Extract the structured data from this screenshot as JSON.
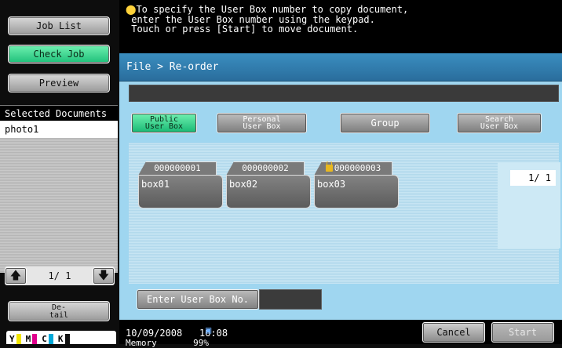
{
  "left": {
    "job_list": "Job List",
    "check_job": "Check Job",
    "preview": "Preview",
    "selected_documents_label": "Selected Documents",
    "selected_documents": [
      "photo1"
    ],
    "page_indicator": "1/ 1",
    "detail_line1": "De-",
    "detail_line2": "tail",
    "toner": [
      {
        "label": "Y",
        "color": "#f2e600"
      },
      {
        "label": "M",
        "color": "#e0008c"
      },
      {
        "label": "C",
        "color": "#00a8d8"
      },
      {
        "label": "K",
        "color": "#111111"
      }
    ]
  },
  "message": {
    "line1": "To specify the User Box number to copy document,",
    "line2": " enter the User Box number using the keypad.",
    "line3": " Touch or press [Start] to move document."
  },
  "main": {
    "breadcrumb": "File > Re-order",
    "tabs": [
      {
        "line1": "Public",
        "line2": "User Box",
        "active": true
      },
      {
        "line1": "Personal",
        "line2": "User Box",
        "active": false
      },
      {
        "line1": "Group",
        "line2": "",
        "active": false
      },
      {
        "line1": "Search",
        "line2": "User Box",
        "active": false
      }
    ],
    "boxes": [
      {
        "number": "000000001",
        "name": "box01",
        "locked": false
      },
      {
        "number": "000000002",
        "name": "box02",
        "locked": false
      },
      {
        "number": "000000003",
        "name": "box03",
        "locked": true
      }
    ],
    "page_indicator": "1/  1",
    "enter_user_box_label": "Enter User Box No."
  },
  "status": {
    "date": "10/09/2008",
    "time": "16:08",
    "memory_label": "Memory",
    "memory_value": "99%",
    "cancel": "Cancel",
    "start": "Start"
  }
}
